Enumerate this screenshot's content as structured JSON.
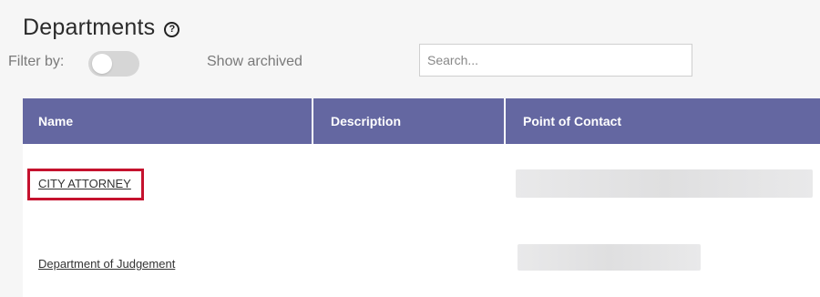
{
  "page": {
    "title": "Departments",
    "help_icon": "question-circle-icon"
  },
  "filters": {
    "filter_label": "Filter by:",
    "toggle_label": "Show archived",
    "toggle_on": false
  },
  "search": {
    "value": "",
    "placeholder": "Search..."
  },
  "table": {
    "columns": [
      "Name",
      "Description",
      "Point of Contact"
    ],
    "rows": [
      {
        "name": "CITY ATTORNEY",
        "description": "",
        "point_of_contact": ""
      },
      {
        "name": "Department of Judgement",
        "description": "",
        "point_of_contact": ""
      }
    ]
  },
  "colors": {
    "header_bg": "#6467a1",
    "highlight": "#c5122e",
    "toggle_off": "#d6d6d6"
  }
}
